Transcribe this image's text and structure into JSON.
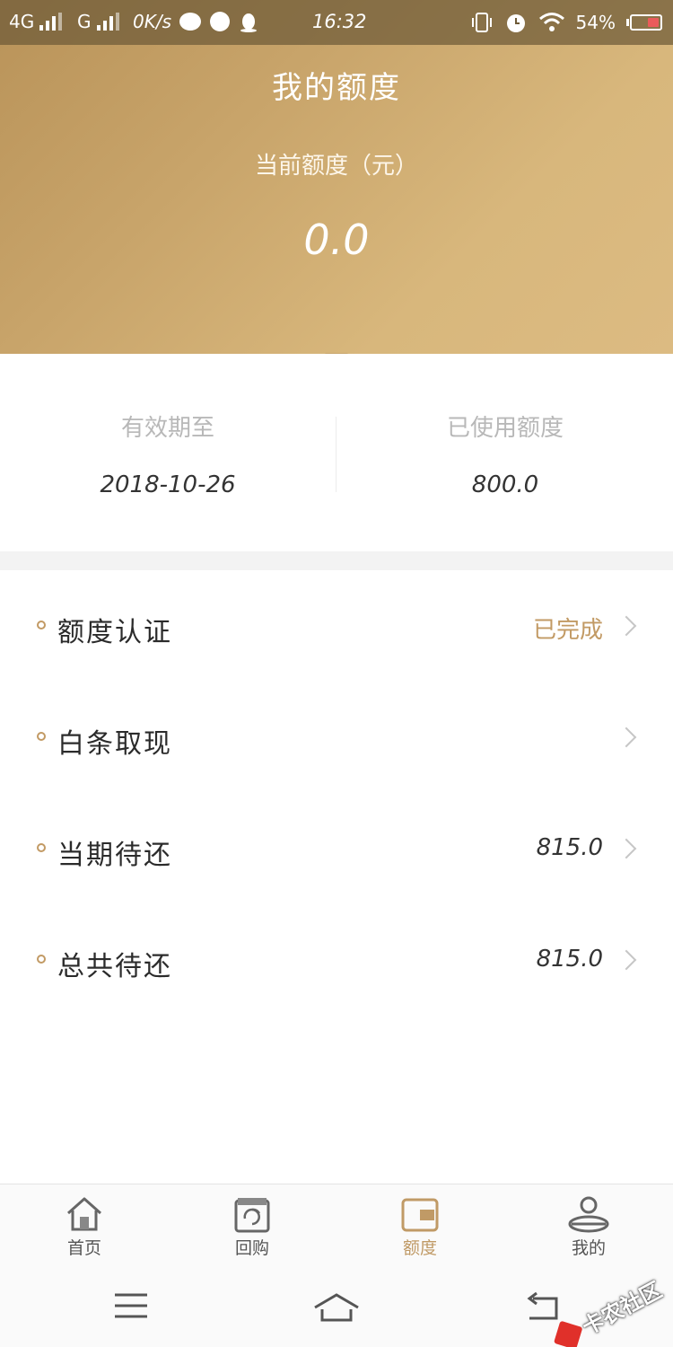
{
  "status_bar": {
    "network_1": "4G",
    "network_2": "G",
    "speed": "0K/s",
    "time": "16:32",
    "battery": "54%",
    "icons_left": [
      "chat-bubble-icon",
      "planet-icon",
      "qq-penguin-icon"
    ],
    "icons_right": [
      "vibrate-icon",
      "alarm-icon",
      "wifi-icon",
      "battery-icon"
    ]
  },
  "header": {
    "title": "我的额度",
    "subtitle": "当前额度（元）",
    "amount": "0.0",
    "gradient_start": "#b99359",
    "gradient_end": "#dcbb82"
  },
  "summary": {
    "left_label": "有效期至",
    "left_value": "2018-10-26",
    "right_label": "已使用额度",
    "right_value": "800.0"
  },
  "list": [
    {
      "label": "额度认证",
      "value": "已完成",
      "value_accent": true
    },
    {
      "label": "白条取现",
      "value": "",
      "value_accent": false
    },
    {
      "label": "当期待还",
      "value": "815.0",
      "value_accent": false
    },
    {
      "label": "总共待还",
      "value": "815.0",
      "value_accent": false
    }
  ],
  "bottom_nav": [
    {
      "label": "首页",
      "icon": "home-icon",
      "active": false
    },
    {
      "label": "回购",
      "icon": "repurchase-bag-icon",
      "active": false
    },
    {
      "label": "额度",
      "icon": "wallet-icon",
      "active": true
    },
    {
      "label": "我的",
      "icon": "profile-icon",
      "active": false
    }
  ],
  "accent_color": "#c09a66",
  "system_nav": [
    "menu-icon",
    "home-arrow-icon",
    "back-icon"
  ],
  "watermark": "卡农社区"
}
